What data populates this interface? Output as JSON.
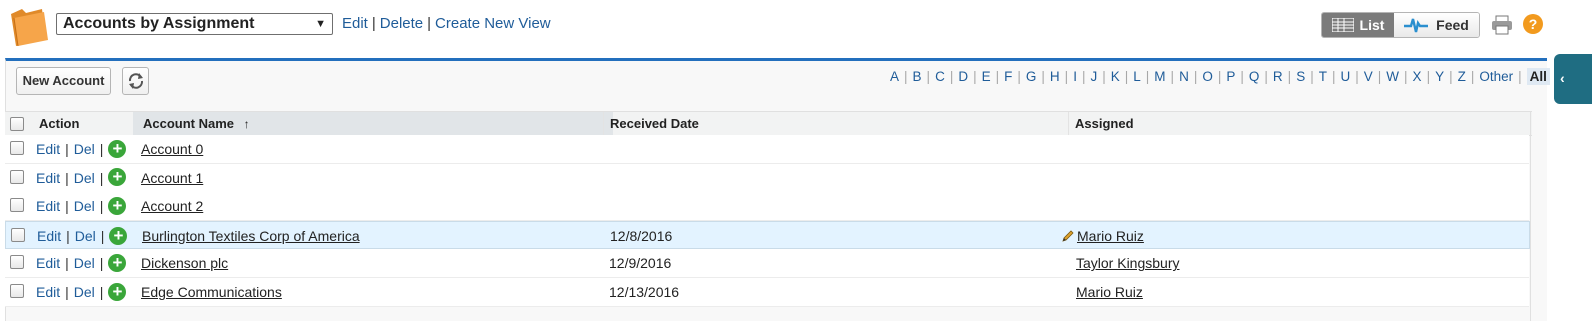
{
  "header": {
    "view_selected": "Accounts by Assignment",
    "links": [
      "Edit",
      "Delete",
      "Create New View"
    ],
    "toggle": {
      "list": "List",
      "feed": "Feed"
    },
    "help_label": "?"
  },
  "toolbar": {
    "new_button": "New Account"
  },
  "alphabet": [
    "A",
    "B",
    "C",
    "D",
    "E",
    "F",
    "G",
    "H",
    "I",
    "J",
    "K",
    "L",
    "M",
    "N",
    "O",
    "P",
    "Q",
    "R",
    "S",
    "T",
    "U",
    "V",
    "W",
    "X",
    "Y",
    "Z",
    "Other",
    "All"
  ],
  "alphabet_active": "All",
  "table": {
    "columns": [
      "Action",
      "Account Name",
      "Received Date",
      "Assigned"
    ],
    "sort_indicator": "↑",
    "action_labels": {
      "edit": "Edit",
      "del": "Del"
    },
    "rows": [
      {
        "name": "Account 0",
        "received": "",
        "assigned": ""
      },
      {
        "name": "Account 1",
        "received": "",
        "assigned": ""
      },
      {
        "name": "Account 2",
        "received": "",
        "assigned": ""
      },
      {
        "name": "Burlington Textiles Corp of America",
        "received": "12/8/2016",
        "assigned": "Mario Ruiz"
      },
      {
        "name": "Dickenson plc",
        "received": "12/9/2016",
        "assigned": "Taylor Kingsbury"
      },
      {
        "name": "Edge Communications",
        "received": "12/13/2016",
        "assigned": "Mario Ruiz"
      }
    ]
  },
  "colors": {
    "accent_blue": "#236fbd",
    "link": "#1f5c99",
    "highlight_row": "#e3f3ff",
    "help": "#f29a1e"
  }
}
